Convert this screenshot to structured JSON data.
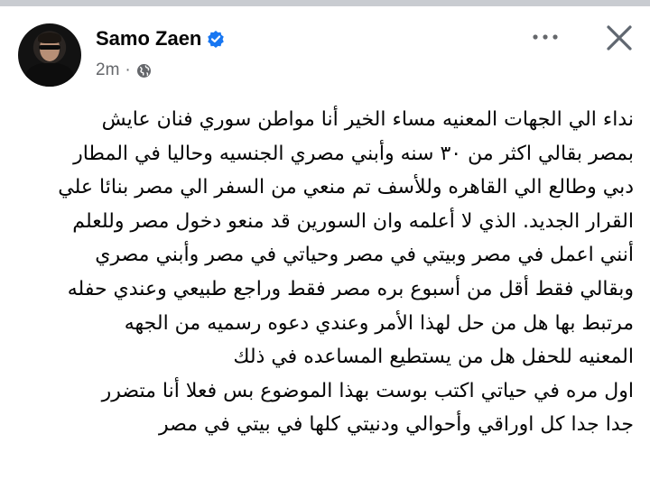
{
  "post": {
    "author": "Samo Zaen",
    "time": "2m",
    "separator": "·",
    "verified_icon": "verified-badge-icon",
    "audience_icon": "globe-icon",
    "accent_color": "#1877f2",
    "lines": [
      "نداء الي الجهات المعنيه مساء الخير أنا مواطن سوري فنان عايش",
      "بمصر بقالي اكثر من ٣٠ سنه وأبني مصري الجنسيه وحاليا في المطار",
      "دبي وطالع الي القاهره  وللأسف تم منعي من السفر الي مصر بنائا علي",
      "القرار الجديد. الذي لا أعلمه وان السورين قد منعو دخول مصر وللعلم",
      "أنني اعمل في مصر وبيتي في مصر وحياتي في مصر وأبني مصري",
      "وبقالي فقط أقل من أسبوع بره مصر فقط وراجع طبيعي وعندي حفله",
      "مرتبط بها  هل من حل لهذا الأمر وعندي دعوه رسميه من الجهه",
      "المعنيه  للحفل هل من يستطيع المساعده في ذلك",
      "اول مره في حياتي اكتب بوست بهذا الموضوع بس فعلا أنا متضرر",
      "جدا جدا كل اوراقي وأحوالي ودنيتي كلها في بيتي في مصر"
    ]
  },
  "header": {
    "more_icon": "more-options-icon",
    "close_icon": "close-icon"
  }
}
